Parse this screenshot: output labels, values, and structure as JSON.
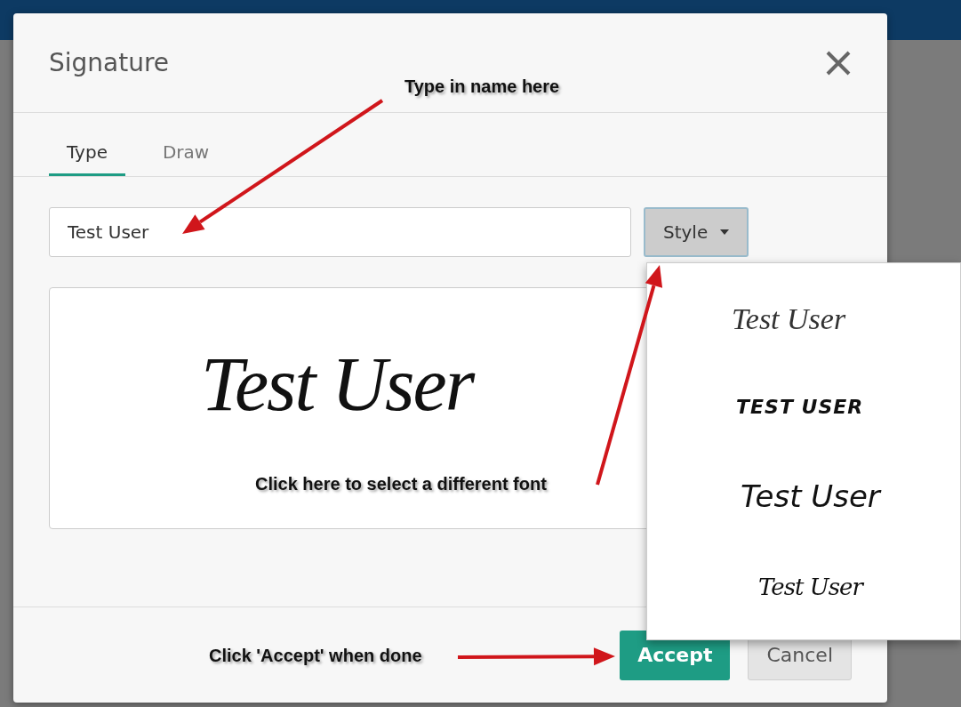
{
  "dialog": {
    "title": "Signature"
  },
  "tabs": [
    {
      "label": "Type",
      "selected": true
    },
    {
      "label": "Draw",
      "selected": false
    }
  ],
  "name_field": {
    "value": "Test User"
  },
  "style_button": {
    "label": "Style",
    "expanded": true
  },
  "preview": {
    "signature": "Test User"
  },
  "style_menu": [
    {
      "kind": "script",
      "text": "Test User"
    },
    {
      "kind": "caps",
      "text": "TEST USER"
    },
    {
      "kind": "print",
      "text": "Test User"
    },
    {
      "kind": "scrawl",
      "text": "Test User"
    }
  ],
  "buttons": [
    {
      "label": "Accept",
      "kind": "primary"
    },
    {
      "label": "Cancel",
      "kind": "secondary"
    }
  ],
  "annotations": [
    {
      "text": "Type in name here"
    },
    {
      "text": "Click here to select a different font"
    },
    {
      "text": "Click 'Accept' when done"
    }
  ]
}
